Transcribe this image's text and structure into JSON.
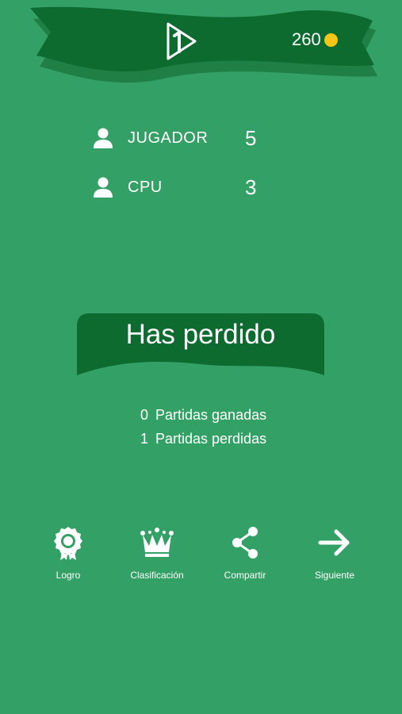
{
  "header": {
    "level_icon": "level-one-play-icon",
    "coins": "260",
    "coin_icon": "gold-coin-icon",
    "coin_color": "#f5c518"
  },
  "players": [
    {
      "name": "JUGADOR",
      "score": "5",
      "icon": "user-icon"
    },
    {
      "name": "CPU",
      "score": "3",
      "icon": "user-icon"
    }
  ],
  "result": {
    "text": "Has perdido"
  },
  "stats": [
    {
      "count": "0",
      "label": "Partidas ganadas"
    },
    {
      "count": "1",
      "label": "Partidas perdidas"
    }
  ],
  "actions": [
    {
      "label": "Logro",
      "icon": "award-ribbon-icon"
    },
    {
      "label": "Clasificación",
      "icon": "crown-icon"
    },
    {
      "label": "Compartir",
      "icon": "share-icon"
    },
    {
      "label": "Siguiente",
      "icon": "arrow-right-icon"
    }
  ],
  "colors": {
    "background": "#33a065",
    "banner": "#0d6b30",
    "banner_shadow": "#1f7f45"
  }
}
